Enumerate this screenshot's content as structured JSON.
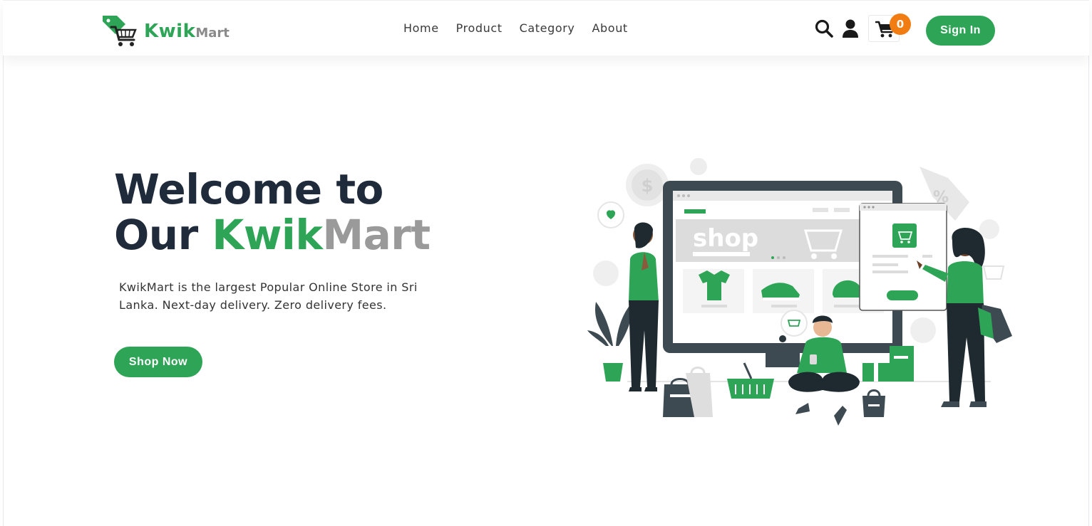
{
  "brand": {
    "name_primary": "Kwik",
    "name_secondary": "Mart"
  },
  "nav": {
    "links": [
      {
        "label": "Home"
      },
      {
        "label": "Product"
      },
      {
        "label": "Category"
      },
      {
        "label": "About"
      }
    ]
  },
  "header": {
    "cart_count": "0",
    "signin_label": "Sign In"
  },
  "hero": {
    "title_line1": "Welcome to",
    "title_line2_prefix": "Our ",
    "title_kwik": "Kwik",
    "title_mart": "Mart",
    "description": "KwikMart is the largest Popular Online Store in Sri Lanka. Next-day delivery. Zero delivery fees.",
    "cta_label": "Shop Now"
  },
  "illustration": {
    "screen_text": "shop"
  },
  "colors": {
    "accent": "#2ea556",
    "badge": "#f07c12",
    "dark": "#1f2a3a",
    "muted": "#9a9a9a"
  }
}
